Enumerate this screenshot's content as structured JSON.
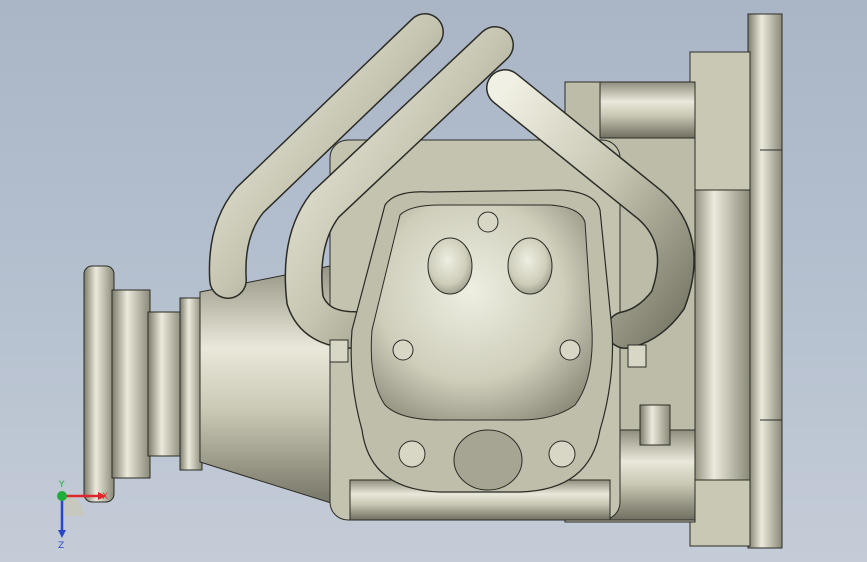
{
  "viewport": {
    "background_top": "#aab6c6",
    "background_bottom": "#c4ccd7",
    "model": {
      "metal_light": "#ececdf",
      "metal_mid": "#c9c8b4",
      "metal_dark": "#7d7c6c",
      "edge": "#2b2b26"
    }
  },
  "triad": {
    "x_label": "X",
    "y_label": "Y",
    "z_label": "Z",
    "x_color": "#e0262b",
    "y_color": "#1fae3a",
    "z_color": "#2a46c8"
  }
}
